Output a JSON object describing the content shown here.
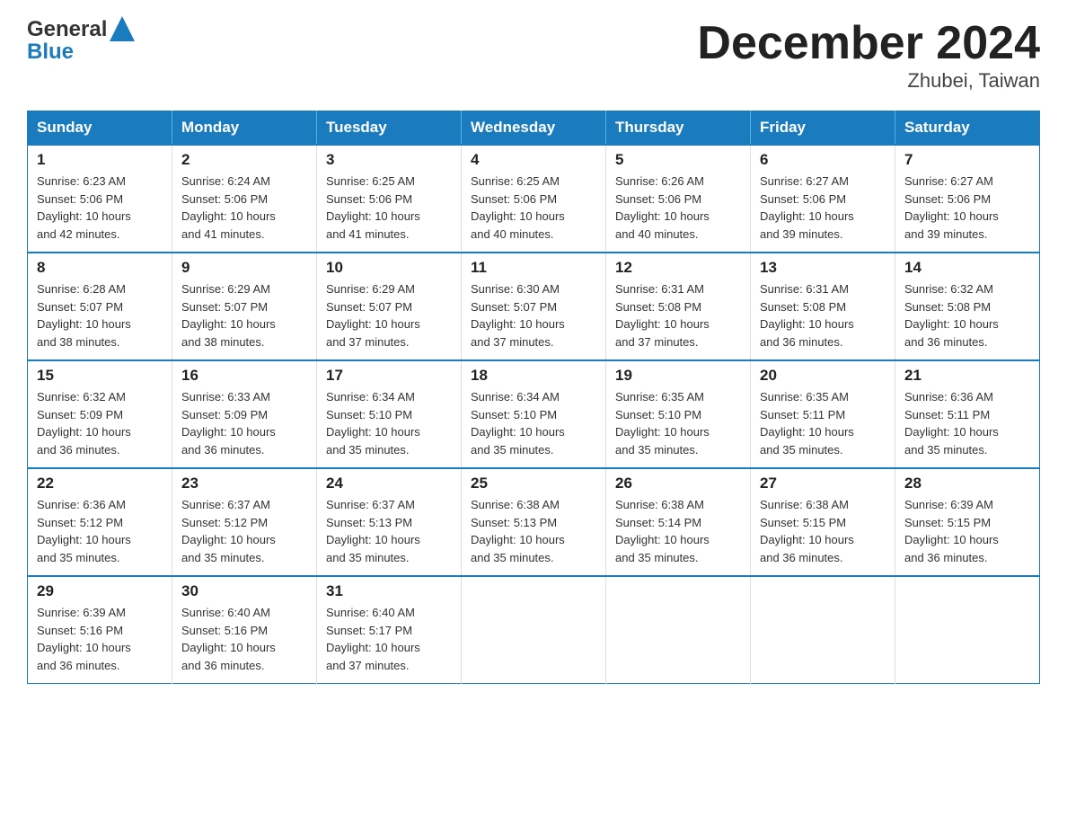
{
  "header": {
    "logo_line1": "General",
    "logo_line2": "Blue",
    "month_title": "December 2024",
    "location": "Zhubei, Taiwan"
  },
  "days_of_week": [
    "Sunday",
    "Monday",
    "Tuesday",
    "Wednesday",
    "Thursday",
    "Friday",
    "Saturday"
  ],
  "weeks": [
    [
      {
        "day": "1",
        "sunrise": "6:23 AM",
        "sunset": "5:06 PM",
        "daylight": "10 hours and 42 minutes."
      },
      {
        "day": "2",
        "sunrise": "6:24 AM",
        "sunset": "5:06 PM",
        "daylight": "10 hours and 41 minutes."
      },
      {
        "day": "3",
        "sunrise": "6:25 AM",
        "sunset": "5:06 PM",
        "daylight": "10 hours and 41 minutes."
      },
      {
        "day": "4",
        "sunrise": "6:25 AM",
        "sunset": "5:06 PM",
        "daylight": "10 hours and 40 minutes."
      },
      {
        "day": "5",
        "sunrise": "6:26 AM",
        "sunset": "5:06 PM",
        "daylight": "10 hours and 40 minutes."
      },
      {
        "day": "6",
        "sunrise": "6:27 AM",
        "sunset": "5:06 PM",
        "daylight": "10 hours and 39 minutes."
      },
      {
        "day": "7",
        "sunrise": "6:27 AM",
        "sunset": "5:06 PM",
        "daylight": "10 hours and 39 minutes."
      }
    ],
    [
      {
        "day": "8",
        "sunrise": "6:28 AM",
        "sunset": "5:07 PM",
        "daylight": "10 hours and 38 minutes."
      },
      {
        "day": "9",
        "sunrise": "6:29 AM",
        "sunset": "5:07 PM",
        "daylight": "10 hours and 38 minutes."
      },
      {
        "day": "10",
        "sunrise": "6:29 AM",
        "sunset": "5:07 PM",
        "daylight": "10 hours and 37 minutes."
      },
      {
        "day": "11",
        "sunrise": "6:30 AM",
        "sunset": "5:07 PM",
        "daylight": "10 hours and 37 minutes."
      },
      {
        "day": "12",
        "sunrise": "6:31 AM",
        "sunset": "5:08 PM",
        "daylight": "10 hours and 37 minutes."
      },
      {
        "day": "13",
        "sunrise": "6:31 AM",
        "sunset": "5:08 PM",
        "daylight": "10 hours and 36 minutes."
      },
      {
        "day": "14",
        "sunrise": "6:32 AM",
        "sunset": "5:08 PM",
        "daylight": "10 hours and 36 minutes."
      }
    ],
    [
      {
        "day": "15",
        "sunrise": "6:32 AM",
        "sunset": "5:09 PM",
        "daylight": "10 hours and 36 minutes."
      },
      {
        "day": "16",
        "sunrise": "6:33 AM",
        "sunset": "5:09 PM",
        "daylight": "10 hours and 36 minutes."
      },
      {
        "day": "17",
        "sunrise": "6:34 AM",
        "sunset": "5:10 PM",
        "daylight": "10 hours and 35 minutes."
      },
      {
        "day": "18",
        "sunrise": "6:34 AM",
        "sunset": "5:10 PM",
        "daylight": "10 hours and 35 minutes."
      },
      {
        "day": "19",
        "sunrise": "6:35 AM",
        "sunset": "5:10 PM",
        "daylight": "10 hours and 35 minutes."
      },
      {
        "day": "20",
        "sunrise": "6:35 AM",
        "sunset": "5:11 PM",
        "daylight": "10 hours and 35 minutes."
      },
      {
        "day": "21",
        "sunrise": "6:36 AM",
        "sunset": "5:11 PM",
        "daylight": "10 hours and 35 minutes."
      }
    ],
    [
      {
        "day": "22",
        "sunrise": "6:36 AM",
        "sunset": "5:12 PM",
        "daylight": "10 hours and 35 minutes."
      },
      {
        "day": "23",
        "sunrise": "6:37 AM",
        "sunset": "5:12 PM",
        "daylight": "10 hours and 35 minutes."
      },
      {
        "day": "24",
        "sunrise": "6:37 AM",
        "sunset": "5:13 PM",
        "daylight": "10 hours and 35 minutes."
      },
      {
        "day": "25",
        "sunrise": "6:38 AM",
        "sunset": "5:13 PM",
        "daylight": "10 hours and 35 minutes."
      },
      {
        "day": "26",
        "sunrise": "6:38 AM",
        "sunset": "5:14 PM",
        "daylight": "10 hours and 35 minutes."
      },
      {
        "day": "27",
        "sunrise": "6:38 AM",
        "sunset": "5:15 PM",
        "daylight": "10 hours and 36 minutes."
      },
      {
        "day": "28",
        "sunrise": "6:39 AM",
        "sunset": "5:15 PM",
        "daylight": "10 hours and 36 minutes."
      }
    ],
    [
      {
        "day": "29",
        "sunrise": "6:39 AM",
        "sunset": "5:16 PM",
        "daylight": "10 hours and 36 minutes."
      },
      {
        "day": "30",
        "sunrise": "6:40 AM",
        "sunset": "5:16 PM",
        "daylight": "10 hours and 36 minutes."
      },
      {
        "day": "31",
        "sunrise": "6:40 AM",
        "sunset": "5:17 PM",
        "daylight": "10 hours and 37 minutes."
      },
      null,
      null,
      null,
      null
    ]
  ],
  "labels": {
    "sunrise": "Sunrise:",
    "sunset": "Sunset:",
    "daylight": "Daylight:"
  }
}
